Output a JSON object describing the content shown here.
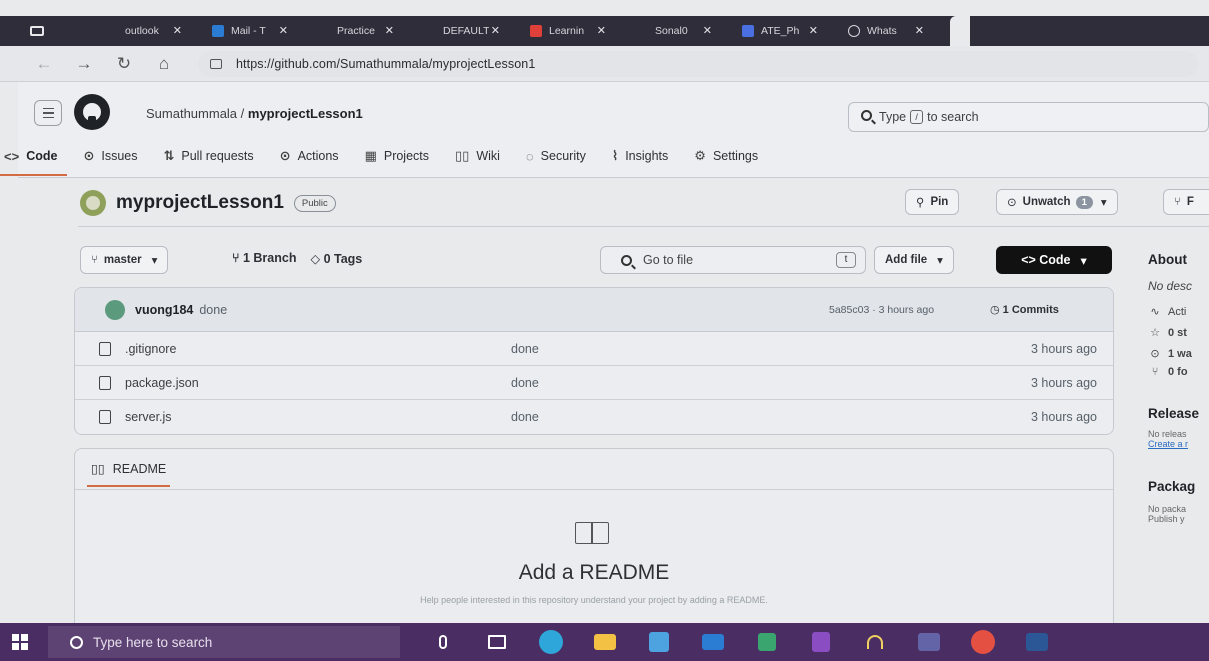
{
  "browser": {
    "tabs": [
      {
        "label": "outlook",
        "icon": "outlook-icon",
        "color": "#2f2d3a"
      },
      {
        "label": "Mail - T",
        "icon": "mail-icon",
        "color": "#2b7cd3"
      },
      {
        "label": "Practice",
        "icon": "page-icon",
        "color": "#2f2d3a"
      },
      {
        "label": "DEFAULT",
        "icon": "page-icon",
        "color": "#2f2d3a"
      },
      {
        "label": "Learnin",
        "icon": "learning-icon",
        "color": "#e0403a"
      },
      {
        "label": "Sonal0",
        "icon": "page-icon",
        "color": "#2f2d3a"
      },
      {
        "label": "ATE_Ph",
        "icon": "doc-icon",
        "color": "#4a6fe0"
      },
      {
        "label": "Whats",
        "icon": "whatsapp-icon",
        "color": "#2f2d3a"
      }
    ],
    "url": "https://github.com/Sumathummala/myprojectLesson1"
  },
  "github": {
    "owner": "Sumathummala",
    "separator": " / ",
    "repo": "myprojectLesson1",
    "search_prefix": "Type",
    "search_key": "/",
    "search_suffix": "to search",
    "nav": [
      {
        "label": "Code",
        "icon": "<>",
        "name": "code"
      },
      {
        "label": "Issues",
        "icon": "⊙",
        "name": "issues"
      },
      {
        "label": "Pull requests",
        "icon": "⇅",
        "name": "pull-requests"
      },
      {
        "label": "Actions",
        "icon": "⊙",
        "name": "actions"
      },
      {
        "label": "Projects",
        "icon": "▦",
        "name": "projects"
      },
      {
        "label": "Wiki",
        "icon": "▯▯",
        "name": "wiki"
      },
      {
        "label": "Security",
        "icon": "◌",
        "name": "security"
      },
      {
        "label": "Insights",
        "icon": "⌇",
        "name": "insights"
      },
      {
        "label": "Settings",
        "icon": "⚙",
        "name": "settings"
      }
    ]
  },
  "repo": {
    "name": "myprojectLesson1",
    "visibility": "Public",
    "pin_label": "Pin",
    "unwatch_label": "Unwatch",
    "watch_count": "1",
    "fork_initial": "F"
  },
  "toolbar": {
    "branch": "master",
    "branches": "1 Branch",
    "tags": "0 Tags",
    "goto_placeholder": "Go to file",
    "goto_key": "t",
    "add_file": "Add file",
    "code": "<> Code"
  },
  "commit": {
    "user": "vuong184",
    "message": "done",
    "hash_time": "5a85c03 · 3 hours ago",
    "commits": "1 Commits"
  },
  "files": [
    {
      "name": ".gitignore",
      "message": "done",
      "age": "3 hours ago"
    },
    {
      "name": "package.json",
      "message": "done",
      "age": "3 hours ago"
    },
    {
      "name": "server.js",
      "message": "done",
      "age": "3 hours ago"
    }
  ],
  "readme": {
    "tab": "README",
    "title": "Add a README",
    "subtitle": "Help people interested in this repository understand your project by adding a README."
  },
  "sidebar": {
    "about": "About",
    "no_desc": "No desc",
    "activity": "Acti",
    "stars": "0 st",
    "watching": "1 wa",
    "forks": "0 fo",
    "releases": "Release",
    "no_releases": "No releas",
    "create_release": "Create a r",
    "packages": "Packag",
    "no_packages": "No packa",
    "publish": "Publish y"
  },
  "taskbar": {
    "search_placeholder": "Type here to search",
    "apps": [
      {
        "name": "microphone-icon",
        "color": "#ffffff"
      },
      {
        "name": "task-view-icon",
        "color": "#ffffff"
      },
      {
        "name": "edge-icon",
        "color": "#2fa6d9"
      },
      {
        "name": "file-explorer-icon",
        "color": "#f3c244"
      },
      {
        "name": "store-icon",
        "color": "#4da3e0"
      },
      {
        "name": "mail-icon",
        "color": "#2b7cd3"
      },
      {
        "name": "app-icon",
        "color": "#3aa56e"
      },
      {
        "name": "onenote-icon",
        "color": "#8a4dc2"
      },
      {
        "name": "headset-icon",
        "color": "#f0d060"
      },
      {
        "name": "teams-icon",
        "color": "#6264a7"
      },
      {
        "name": "chrome-icon",
        "color": "#e45142"
      },
      {
        "name": "word-icon",
        "color": "#2b5797"
      }
    ]
  }
}
